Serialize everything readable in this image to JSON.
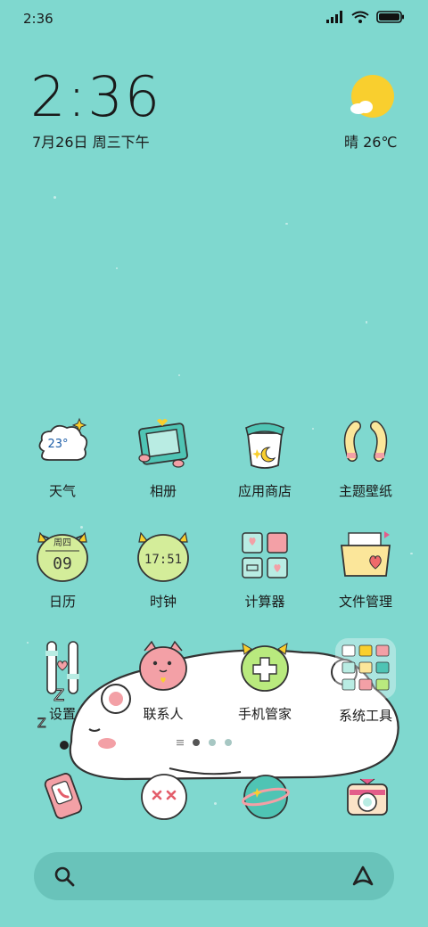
{
  "status": {
    "time": "2:36"
  },
  "clock": {
    "time": "2:36",
    "date": "7月26日 周三下午"
  },
  "weather": {
    "text": "晴 26℃",
    "widget_temp": "23°"
  },
  "apps": [
    {
      "label": "天气",
      "icon": "weather-cloud-icon"
    },
    {
      "label": "相册",
      "icon": "photo-frame-icon"
    },
    {
      "label": "应用商店",
      "icon": "app-store-jar-icon"
    },
    {
      "label": "主题壁纸",
      "icon": "theme-wallpaper-icon"
    },
    {
      "label": "日历",
      "icon": "calendar-icon",
      "text_top": "周四",
      "text_bottom": "09"
    },
    {
      "label": "时钟",
      "icon": "alarm-clock-icon",
      "text": "17:51"
    },
    {
      "label": "计算器",
      "icon": "calculator-icon"
    },
    {
      "label": "文件管理",
      "icon": "file-manager-icon"
    },
    {
      "label": "设置",
      "icon": "settings-icon"
    },
    {
      "label": "联系人",
      "icon": "contacts-cat-icon"
    },
    {
      "label": "手机管家",
      "icon": "phone-manager-icon"
    },
    {
      "label": "系统工具",
      "icon": "system-tools-folder-icon"
    }
  ],
  "dock": [
    {
      "name": "phone-icon"
    },
    {
      "name": "messages-icon"
    },
    {
      "name": "browser-planet-icon"
    },
    {
      "name": "camera-icon"
    }
  ],
  "pager": {
    "pages": 3,
    "active": 1
  },
  "colors": {
    "background": "#7fd8cf",
    "sun": "#f9cf2e",
    "accent_pink": "#f3a0a6"
  }
}
